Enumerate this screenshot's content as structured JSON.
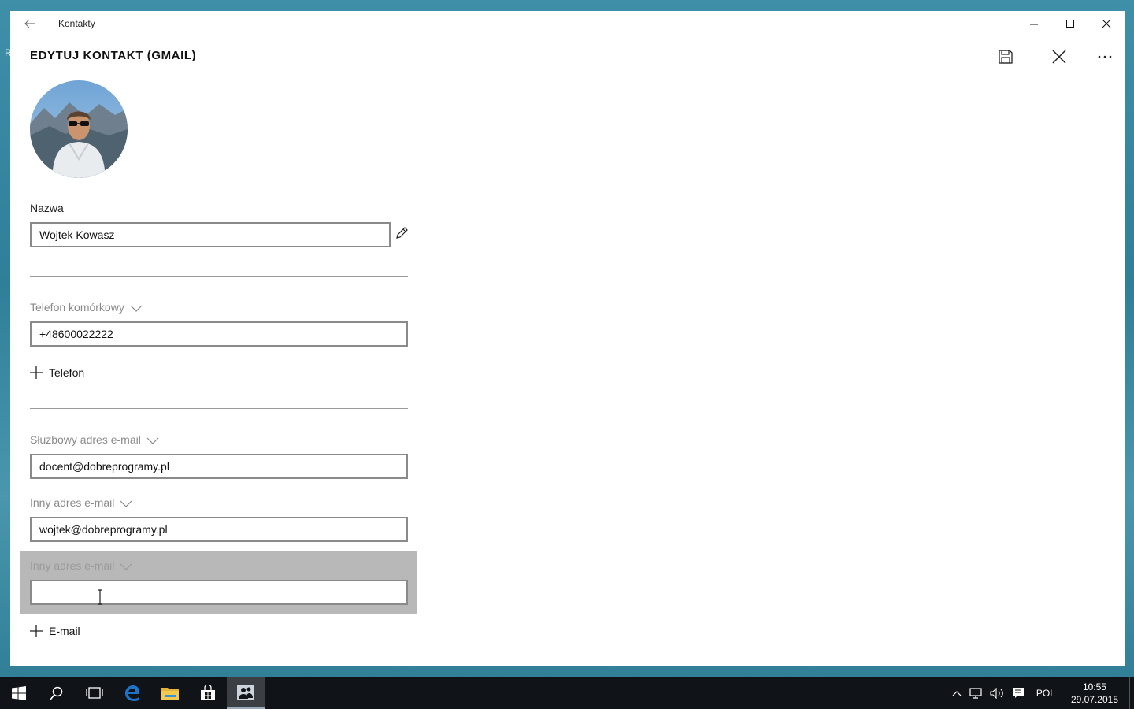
{
  "desktop": {
    "edge_text": "R"
  },
  "window": {
    "app_title": "Kontakty",
    "back_icon": "arrow-left-icon",
    "controls": [
      "minimize-icon",
      "maximize-icon",
      "close-icon"
    ]
  },
  "header": {
    "title": "EDYTUJ KONTAKT (GMAIL)",
    "commands": [
      "save-icon",
      "close-icon",
      "more-icon"
    ]
  },
  "form": {
    "name_label": "Nazwa",
    "name_value": "Wojtek Kowasz",
    "phone_type_label": "Telefon komórkowy",
    "phone_value": "+48600022222",
    "add_phone_label": "Telefon",
    "email1_type_label": "Służbowy adres e-mail",
    "email1_value": "docent@dobreprogramy.pl",
    "email2_type_label": "Inny adres e-mail",
    "email2_value": "wojtek@dobreprogramy.pl",
    "email3_type_label": "Inny adres e-mail",
    "email3_value": "",
    "add_email_label": "E-mail"
  },
  "taskbar": {
    "items": [
      "windows-start-icon",
      "search-icon",
      "task-view-icon",
      "edge-icon",
      "file-explorer-icon",
      "store-icon",
      "people-icon"
    ],
    "tray": {
      "language": "POL",
      "time": "10:55",
      "date": "29.07.2015"
    }
  },
  "colors": {
    "accent_edge": "#1e73c8",
    "folder": "#e6b33a",
    "taskbar_bg": "#101418"
  }
}
